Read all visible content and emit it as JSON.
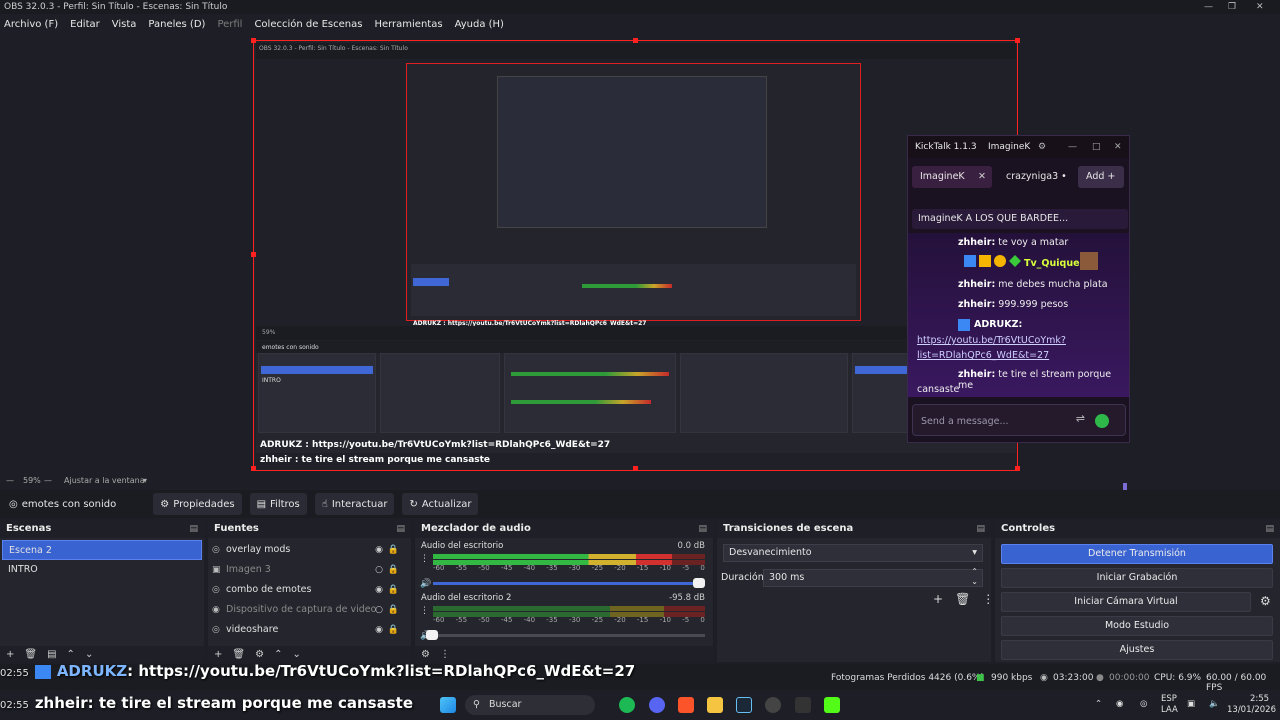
{
  "window": {
    "title": "OBS 32.0.3 - Perfil: Sin Título - Escenas: Sin Título"
  },
  "menu": [
    {
      "label": "Archivo (F)",
      "enabled": true
    },
    {
      "label": "Editar",
      "enabled": true
    },
    {
      "label": "Vista",
      "enabled": true
    },
    {
      "label": "Paneles (D)",
      "enabled": true
    },
    {
      "label": "Perfil",
      "enabled": false
    },
    {
      "label": "Colección de Escenas",
      "enabled": true
    },
    {
      "label": "Herramientas",
      "enabled": true
    },
    {
      "label": "Ayuda (H)",
      "enabled": true
    }
  ],
  "kicktalk": {
    "title": "KickTalk 1.1.3",
    "active_channel": "ImagineK",
    "tabs": [
      {
        "label": "ImagineK"
      },
      {
        "label": "crazyniga3 •"
      }
    ],
    "add_label": "Add",
    "pinned": "ImagineK     A LOS QUE BARDEE...",
    "messages": [
      {
        "user": "zhheir:",
        "text": "te voy a matar"
      },
      {
        "user": "Tv_Quique:",
        "text": ""
      },
      {
        "user": "zhheir:",
        "text": "me debes mucha plata"
      },
      {
        "user": "zhheir:",
        "text": "999.999 pesos"
      },
      {
        "user": "ADRUKZ:",
        "text": ""
      },
      {
        "user": "",
        "text": "https://youtu.be/Tr6VtUCoYmk?"
      },
      {
        "user": "",
        "text": "list=RDlahQPc6_WdE&t=27"
      },
      {
        "user": "zhheir:",
        "text": "te tire el stream porque me"
      },
      {
        "user": "",
        "text": "cansaste"
      }
    ],
    "input_placeholder": "Send a message..."
  },
  "preview": {
    "zoom": "59%",
    "fit_label": "Ajustar a la ventana"
  },
  "source_toolbar": {
    "source_name": "emotes con sonido",
    "properties": "Propiedades",
    "filters": "Filtros",
    "interact": "Interactuar",
    "refresh": "Actualizar"
  },
  "scenes": {
    "title": "Escenas",
    "items": [
      {
        "label": "Escena 2",
        "selected": true
      },
      {
        "label": "INTRO",
        "selected": false
      }
    ]
  },
  "sources": {
    "title": "Fuentes",
    "items": [
      {
        "label": "overlay mods",
        "icon": "browser-icon",
        "visible": true
      },
      {
        "label": "Imagen 3",
        "icon": "image-icon",
        "visible": false
      },
      {
        "label": "combo de emotes",
        "icon": "browser-icon",
        "visible": true
      },
      {
        "label": "Dispositivo de captura de video",
        "icon": "camera-icon",
        "visible": false
      },
      {
        "label": "videoshare",
        "icon": "browser-icon",
        "visible": true
      }
    ]
  },
  "mixer": {
    "title": "Mezclador de audio",
    "ticks": [
      "-60",
      "-55",
      "-50",
      "-45",
      "-40",
      "-35",
      "-30",
      "-25",
      "-20",
      "-15",
      "-10",
      "-5",
      "0"
    ],
    "channels": [
      {
        "name": "Audio del escritorio",
        "db": "0.0 dB",
        "level": 0.88,
        "volume": 1.0
      },
      {
        "name": "Audio del escritorio 2",
        "db": "-95.8 dB",
        "level": 0.0,
        "volume": 0.02
      }
    ]
  },
  "transitions": {
    "title": "Transiciones de escena",
    "selected": "Desvanecimiento",
    "duration_label": "Duración",
    "duration": "300 ms"
  },
  "controls": {
    "title": "Controles",
    "buttons": [
      {
        "label": "Detener Transmisión",
        "active": true
      },
      {
        "label": "Iniciar Grabación",
        "active": false
      },
      {
        "label": "Iniciar Cámara Virtual",
        "active": false
      },
      {
        "label": "Modo Estudio",
        "active": false
      },
      {
        "label": "Ajustes",
        "active": false
      }
    ]
  },
  "status": {
    "dropped": "Fotogramas Perdidos 4426 (0.6%)",
    "bitrate": "990 kbps",
    "stream_time": "03:23:00",
    "rec_time": "00:00:00",
    "cpu": "CPU: 6.9%",
    "fps": "60.00 / 60.00 FPS"
  },
  "overlay_chat": [
    {
      "time": "02:55",
      "user": "ADRUKZ",
      "text": ": https://youtu.be/Tr6VtUCoYmk?list=RDlahQPc6_WdE&t=27"
    },
    {
      "time": "02:55",
      "user": "zhheir",
      "text": ": te tire el stream porque me cansaste"
    }
  ],
  "taskbar": {
    "search": "Buscar",
    "lang1": "ESP",
    "lang2": "LAA",
    "time": "2:55",
    "date": "13/01/2026"
  },
  "nested": {
    "chat1": "ADRUKZ : https://youtu.be/Tr6VtUCoYmk?list=RDlahQPc6_WdE&t=27",
    "chat2": "zhheir : te tire el stream porque me cansaste",
    "source_name": "emotes con sonido",
    "scene_sel": "Escena 2",
    "scene2": "INTRO",
    "kick_title": "KickTalk 1.1.3"
  },
  "colors": {
    "accent": "#3a63d2",
    "border_red": "#ff2020",
    "kick_green": "#2fb84a"
  }
}
